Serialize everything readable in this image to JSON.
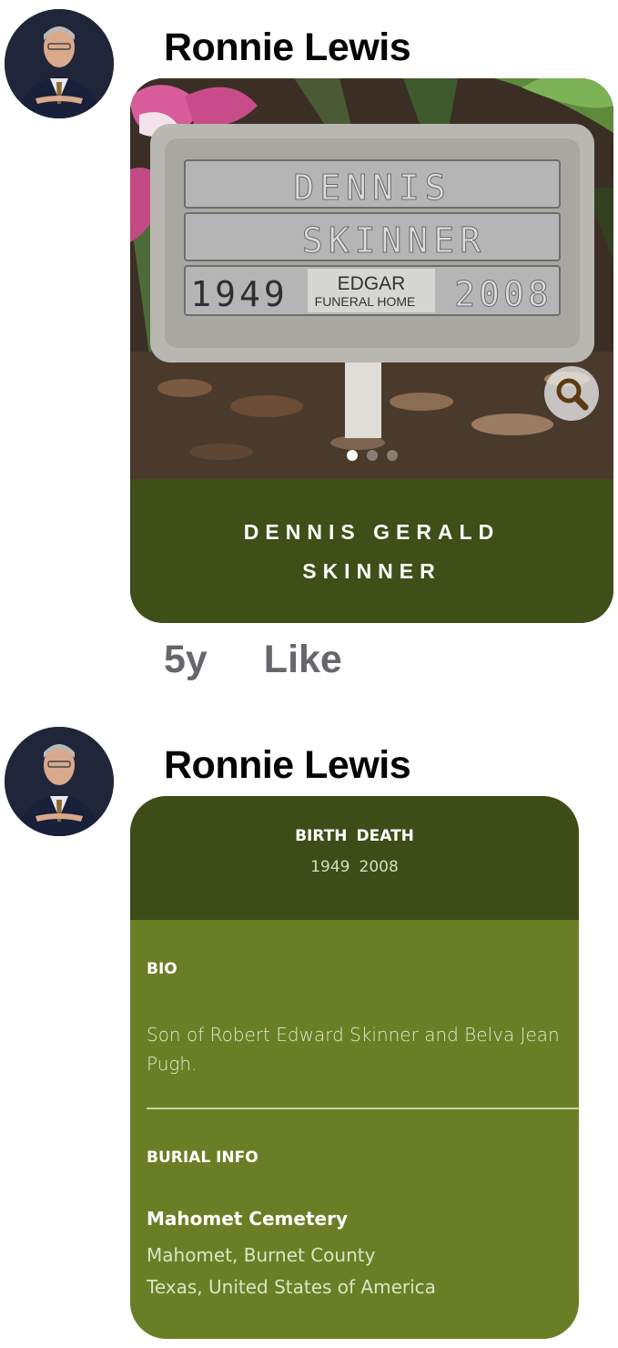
{
  "posts": [
    {
      "author": "Ronnie Lewis",
      "card": {
        "plate": {
          "first_name": "DENNIS",
          "last_name": "SKINNER",
          "birth_year": "1949",
          "death_year": "2008",
          "funeral_home_name": "EDGAR",
          "funeral_home_label": "FUNERAL HOME"
        },
        "name_line_1": "DENNIS GERALD",
        "name_line_2": "SKINNER",
        "carousel_total": 3,
        "carousel_active": 1
      },
      "time": "5y",
      "like_label": "Like"
    },
    {
      "author": "Ronnie Lewis",
      "card": {
        "birth_label": "BIRTH",
        "death_label": "DEATH",
        "birth_year": "1949",
        "death_year": "2008",
        "bio_label": "BIO",
        "bio_text": "Son of Robert Edward Skinner and Belva Jean Pugh.",
        "burial_label": "BURIAL INFO",
        "cemetery_name": "Mahomet Cemetery",
        "location_line_1": "Mahomet, Burnet County",
        "location_line_2": "Texas, United States of America"
      }
    }
  ],
  "colors": {
    "name_band": "#3e4f17",
    "dates_band": "#3e4d17",
    "card_body": "#6a7f25",
    "meta_text": "#65676b"
  }
}
